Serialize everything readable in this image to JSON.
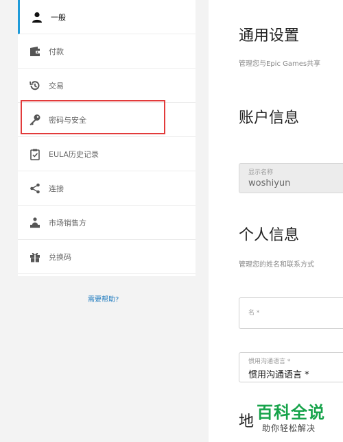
{
  "sidebar": {
    "items": [
      {
        "label": "一般",
        "icon": "person-icon",
        "active": true
      },
      {
        "label": "付款",
        "icon": "wallet-icon"
      },
      {
        "label": "交易",
        "icon": "history-icon"
      },
      {
        "label": "密码与安全",
        "icon": "key-icon"
      },
      {
        "label": "EULA历史记录",
        "icon": "clipboard-check-icon"
      },
      {
        "label": "连接",
        "icon": "share-icon"
      },
      {
        "label": "市场销售方",
        "icon": "seller-icon"
      },
      {
        "label": "兑换码",
        "icon": "gift-icon"
      }
    ],
    "help_link": "需要帮助?",
    "accent_color": "#1f9bd9",
    "highlight_color": "#e23b3b"
  },
  "main": {
    "general_title": "通用设置",
    "general_subtitle": "管理您与Epic Games共享",
    "account_title": "账户信息",
    "display_name": {
      "label": "显示名称",
      "value": "woshiyun"
    },
    "personal_title": "个人信息",
    "personal_subtitle": "管理您的姓名和联系方式",
    "first_name": {
      "label": "名 *",
      "value": ""
    },
    "language": {
      "label": "惯用沟通语言 *",
      "value": "惯用沟通语言 *"
    },
    "address_title_partial": "地"
  },
  "watermark": {
    "logo": "百科全说",
    "tagline": "助你轻松解决",
    "color": "#16a34a"
  }
}
